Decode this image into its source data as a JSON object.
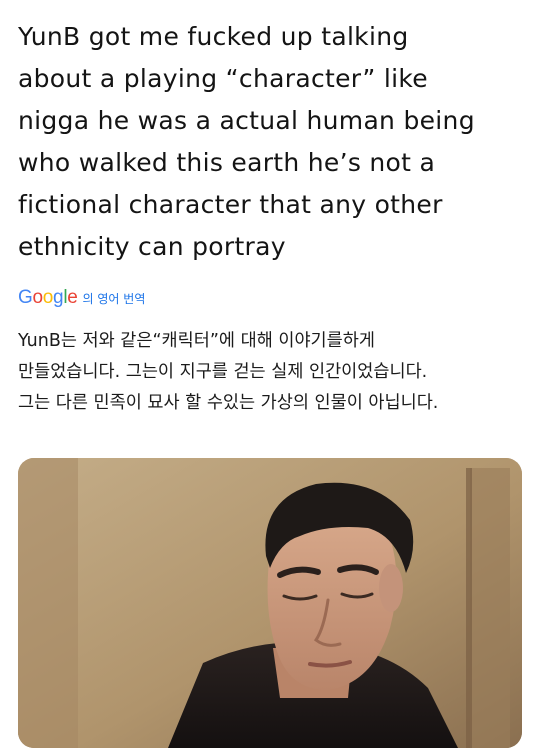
{
  "post": {
    "text_lines": [
      "YunB got me fucked up talking",
      "about a playing “character” like",
      "nigga he was a actual human being",
      "who walked this earth he’s not a",
      "fictional character that any other",
      "ethnicity can portray"
    ]
  },
  "translation": {
    "logo_letters": [
      "G",
      "o",
      "o",
      "g",
      "l",
      "e"
    ],
    "label": "의 영어 번역",
    "text_lines": [
      "YunB는 저와 같은“캐릭터”에 대해 이야기를하게",
      "만들었습니다. 그는이 지구를 걷는 실제 인간이었습니다.",
      "그는 다른 민족이 묘사 할 수있는 가상의 인물이 아닙니다."
    ],
    "logo_colors": [
      "#4285F4",
      "#EA4335",
      "#FBBC05",
      "#4285F4",
      "#34A853",
      "#EA4335"
    ]
  },
  "media": {
    "kind": "photo",
    "subject": "man-with-eyes-closed"
  }
}
